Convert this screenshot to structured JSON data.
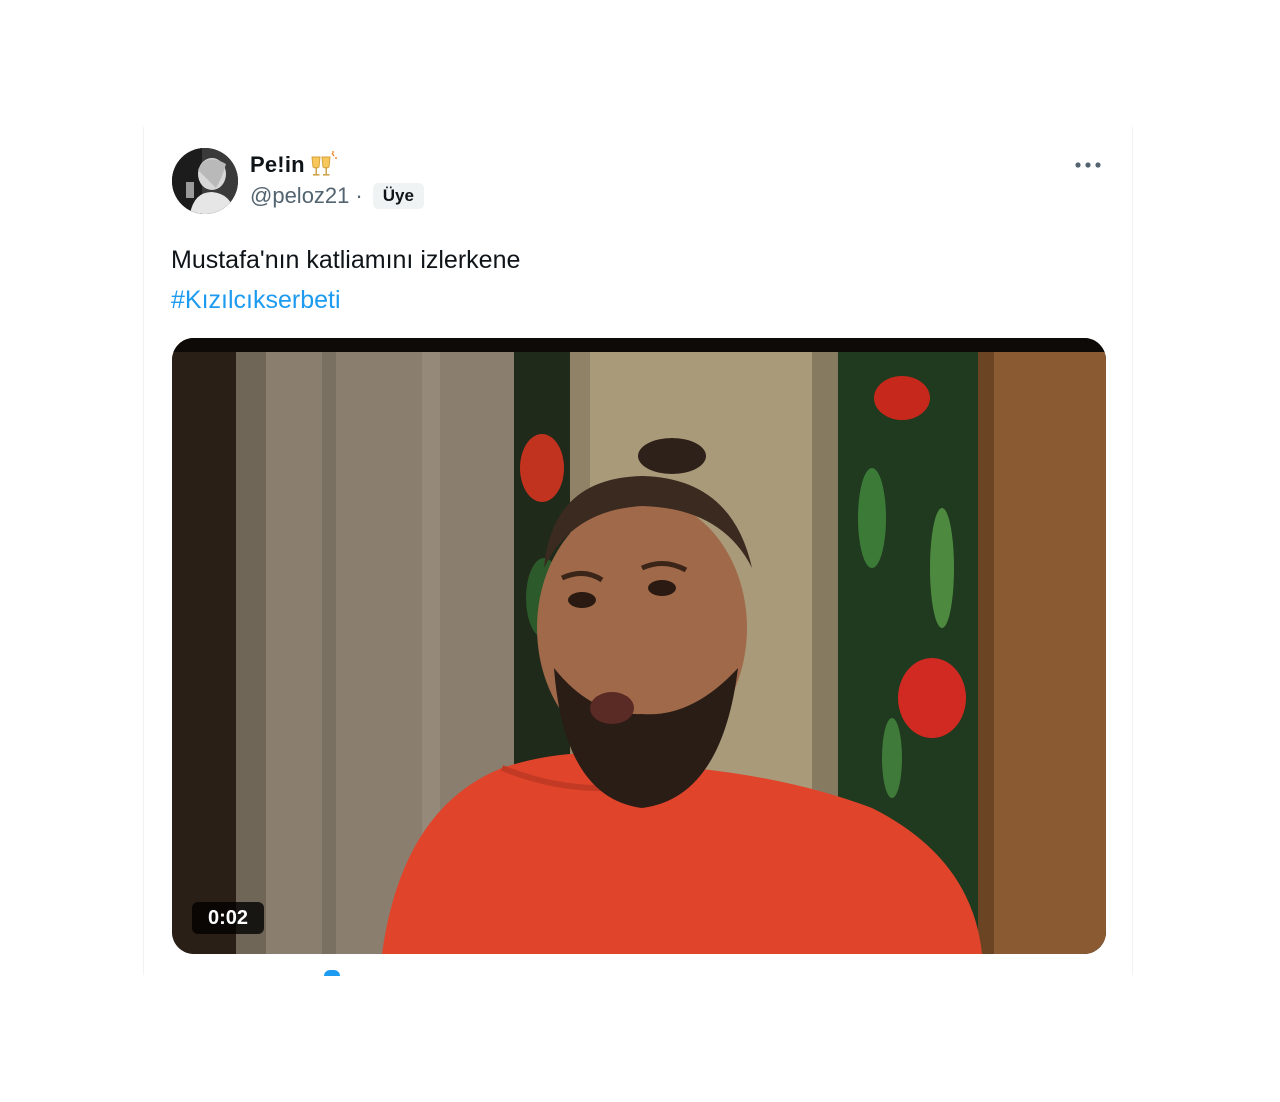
{
  "tweet": {
    "display_name": "Pe!in",
    "name_emoji_icon": "clinking-glasses-icon",
    "handle": "@peloz21",
    "separator": "·",
    "member_badge": "Üye",
    "more_icon": "more-horizontal-icon",
    "text": "Mustafa'nın katliamını izlerkene",
    "hashtag": "#Kızılcıkserbeti"
  },
  "media": {
    "type": "video",
    "duration": "0:02"
  },
  "colors": {
    "link": "#1d9bf0",
    "text_primary": "#0f1419",
    "text_secondary": "#536471"
  }
}
